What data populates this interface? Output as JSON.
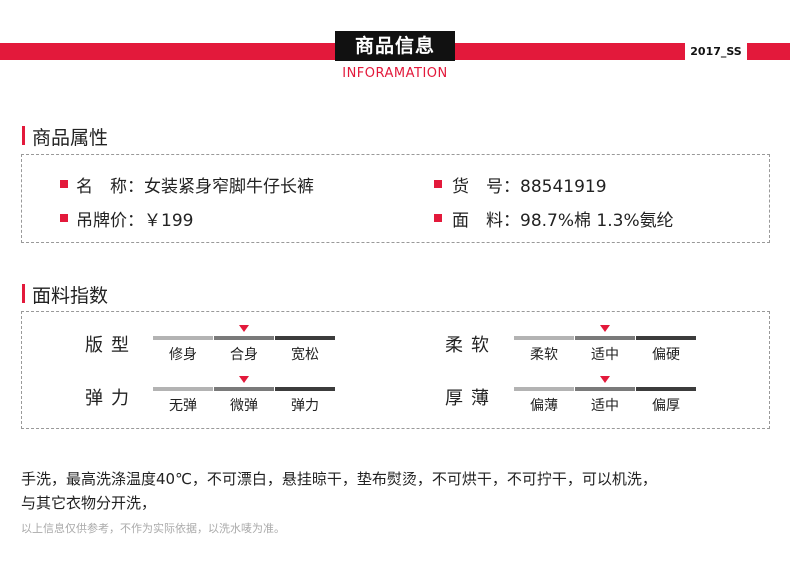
{
  "header": {
    "title": "商品信息",
    "subtitle": "INFORAMATION",
    "season": "2017_SS",
    "accent_color": "#e3193b"
  },
  "attributes": {
    "section_title": "商品属性",
    "name_label": "名　称：",
    "name_value": "女装紧身窄脚牛仔长裤",
    "sku_label": "货　号：",
    "sku_value": "88541919",
    "price_label": "吊牌价：",
    "price_value": "￥199",
    "fabric_label": "面　料：",
    "fabric_value": "98.7%棉 1.3%氨纶"
  },
  "fabric_index": {
    "section_title": "面料指数",
    "scales": [
      {
        "label": "版型",
        "options": [
          "修身",
          "合身",
          "宽松"
        ],
        "selected": 1
      },
      {
        "label": "柔软",
        "options": [
          "柔软",
          "适中",
          "偏硬"
        ],
        "selected": 1
      },
      {
        "label": "弹力",
        "options": [
          "无弹",
          "微弹",
          "弹力"
        ],
        "selected": 1
      },
      {
        "label": "厚薄",
        "options": [
          "偏薄",
          "适中",
          "偏厚"
        ],
        "selected": 1
      }
    ]
  },
  "care": {
    "line1": "手洗，最高洗涤温度40℃，不可漂白，悬挂晾干，垫布熨烫，不可烘干，不可拧干，可以机洗，",
    "line2": "与其它衣物分开洗，",
    "note": "以上信息仅供参考，不作为实际依据，以洗水唛为准。"
  }
}
